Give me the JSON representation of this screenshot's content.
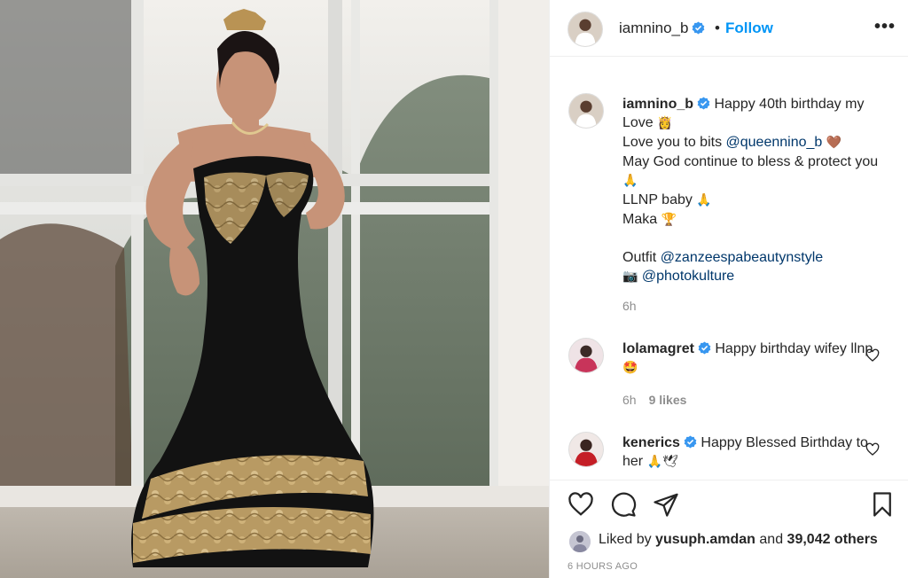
{
  "post": {
    "author": "iamnino_b",
    "follow_label": "Follow",
    "dot_separator": "•"
  },
  "caption": {
    "username": "iamnino_b",
    "line1": "Happy 40th birthday my Love",
    "line1_emoji": "👸",
    "line2_prefix": "Love you to bits ",
    "line2_mention": "@queennino_b",
    "line2_emoji": "🤎",
    "line3": "May God continue to bless & protect you",
    "line3_emoji": "🙏",
    "line4": "LLNP baby",
    "line4_emoji": "🙏",
    "line5": "Maka",
    "line5_emoji": "🏆",
    "line6_prefix": "Outfit ",
    "line6_mention": "@zanzeespabeautynstyle",
    "line7_emoji": "📷",
    "line7_mention": "@photokulture",
    "time": "6h"
  },
  "comments": [
    {
      "username": "lolamagret",
      "text": "Happy birthday wifey llnp",
      "emoji": "🤩",
      "time": "6h",
      "likes": "9 likes"
    },
    {
      "username": "kenerics",
      "text": "Happy Blessed Birthday to her",
      "emoji": "🙏🕊",
      "time": "",
      "likes": ""
    }
  ],
  "likes_bar": {
    "prefix": "Liked by ",
    "user": "yusuph.amdan",
    "middle": " and ",
    "count": "39,042 others"
  },
  "posted_ago": "6 HOURS AGO",
  "icons": {
    "verified": "verified-badge-icon",
    "more": "more-options-icon",
    "like": "heart-icon",
    "comment": "comment-icon",
    "share": "paper-plane-icon",
    "save": "bookmark-icon"
  },
  "colors": {
    "accent": "#0095f6",
    "mention": "#00376b",
    "muted": "#8e8e8e",
    "text": "#262626"
  }
}
